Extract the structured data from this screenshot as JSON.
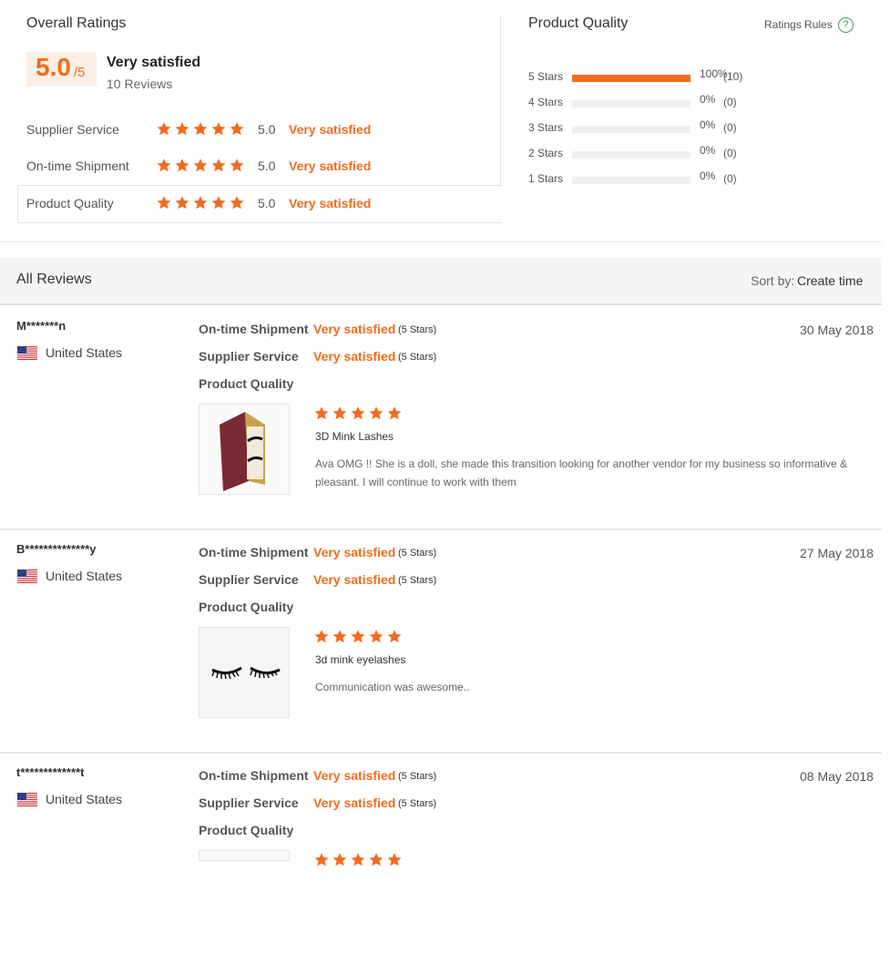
{
  "overall": {
    "title": "Overall Ratings",
    "score": "5.0",
    "score_denominator": "/5",
    "satisfaction": "Very satisfied",
    "reviews_count": "10 Reviews",
    "metrics": [
      {
        "label": "Supplier Service",
        "score": "5.0",
        "text": "Very satisfied",
        "stars": 5
      },
      {
        "label": "On-time Shipment",
        "score": "5.0",
        "text": "Very satisfied",
        "stars": 5
      },
      {
        "label": "Product Quality",
        "score": "5.0",
        "text": "Very satisfied",
        "stars": 5
      }
    ]
  },
  "product_quality": {
    "title": "Product Quality",
    "rules_label": "Ratings Rules",
    "rules_icon": "?",
    "distribution": [
      {
        "label": "5 Stars",
        "pct": "100%",
        "count": "(10)",
        "fraction": 1.0
      },
      {
        "label": "4 Stars",
        "pct": "0%",
        "count": "(0)",
        "fraction": 0
      },
      {
        "label": "3 Stars",
        "pct": "0%",
        "count": "(0)",
        "fraction": 0
      },
      {
        "label": "2 Stars",
        "pct": "0%",
        "count": "(0)",
        "fraction": 0
      },
      {
        "label": "1 Stars",
        "pct": "0%",
        "count": "(0)",
        "fraction": 0
      }
    ]
  },
  "reviews_header": {
    "title": "All Reviews",
    "sort_label": "Sort by:",
    "sort_value": "Create time"
  },
  "reviews": [
    {
      "name": "M*******n",
      "country": "United States",
      "date": "30 May 2018",
      "shipment_label": "On-time Shipment",
      "shipment_value": "Very satisfied",
      "shipment_stars": "(5 Stars)",
      "service_label": "Supplier Service",
      "service_value": "Very satisfied",
      "service_stars": "(5 Stars)",
      "quality_label": "Product Quality",
      "product": "3D Mink Lashes",
      "text": "Ava OMG !! She is a doll, she made this transition looking for another vendor for my business so informative & pleasant. I will continue to work with them",
      "stars": 5
    },
    {
      "name": "B**************y",
      "country": "United States",
      "date": "27 May 2018",
      "shipment_label": "On-time Shipment",
      "shipment_value": "Very satisfied",
      "shipment_stars": "(5 Stars)",
      "service_label": "Supplier Service",
      "service_value": "Very satisfied",
      "service_stars": "(5 Stars)",
      "quality_label": "Product Quality",
      "product": "3d mink eyelashes",
      "text": "Communication was awesome..",
      "stars": 5
    },
    {
      "name": "t*************t",
      "country": "United States",
      "date": "08 May 2018",
      "shipment_label": "On-time Shipment",
      "shipment_value": "Very satisfied",
      "shipment_stars": "(5 Stars)",
      "service_label": "Supplier Service",
      "service_value": "Very satisfied",
      "service_stars": "(5 Stars)",
      "quality_label": "Product Quality",
      "product": "",
      "text": "",
      "stars": 5
    }
  ],
  "colors": {
    "accent": "#f26b1d",
    "rules_icon": "#3b9b5b"
  },
  "icons": {
    "star": "star-icon",
    "flag": "us-flag-icon",
    "help": "help-circle-icon"
  }
}
